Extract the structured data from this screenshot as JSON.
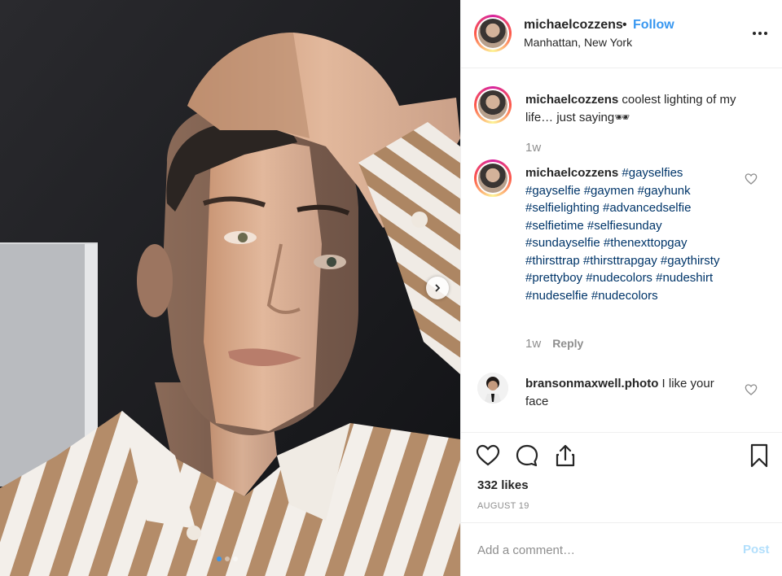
{
  "post": {
    "username": "michaelcozzens",
    "separator": "•",
    "follow_label": "Follow",
    "location": "Manhattan, New York"
  },
  "caption": {
    "username": "michaelcozzens",
    "text": " coolest lighting of my life… just saying🕶",
    "age": "1w"
  },
  "hashtag_comment": {
    "username": "michaelcozzens",
    "hashtags": "#gayselfies #gayselfie #gaymen #gayhunk #selfielighting #advancedselfie #selfietime #selfiesunday #sundayselfie #thenexttopgay #thirsttrap #thirsttrapgay #gaythirsty #prettyboy #nudecolors #nudeshirt #nudeselfie #nudecolors",
    "age": "1w",
    "reply_label": "Reply"
  },
  "other_comment": {
    "username": "bransonmaxwell.photo",
    "text": " I like your face"
  },
  "stats": {
    "likes": "332 likes",
    "date": "AUGUST 19"
  },
  "composer": {
    "placeholder": "Add a comment…",
    "post_label": "Post"
  },
  "carousel": {
    "dot_count": 3,
    "active_index": 0
  },
  "colors": {
    "link_blue": "#3897f0",
    "hashtag_navy": "#003569",
    "muted_gray": "#8e8e8e",
    "post_disabled": "#b2dffc"
  },
  "icons": [
    "more-icon",
    "heart-icon",
    "comment-icon",
    "share-icon",
    "bookmark-icon",
    "chevron-right-icon"
  ]
}
